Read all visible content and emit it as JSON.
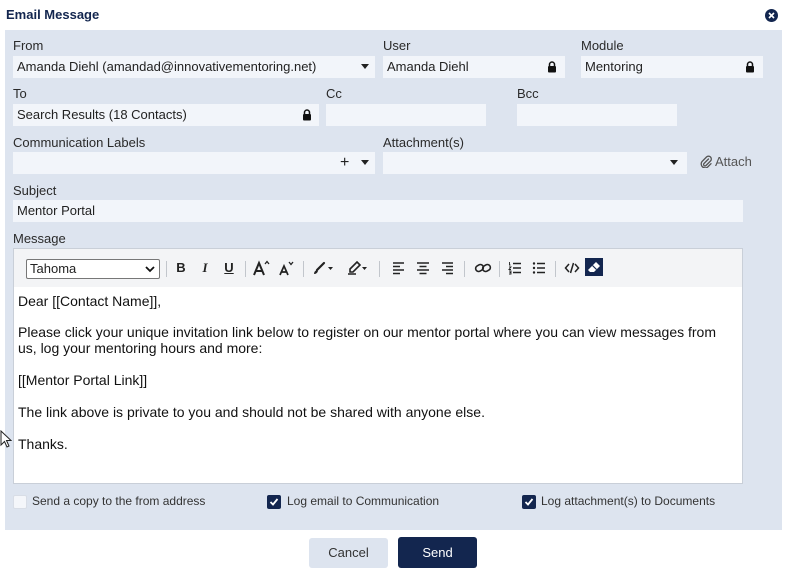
{
  "dialog": {
    "title": "Email Message"
  },
  "from": {
    "label": "From",
    "value": "Amanda Diehl (amandad@innovativementoring.net)"
  },
  "user": {
    "label": "User",
    "value": "Amanda Diehl"
  },
  "module": {
    "label": "Module",
    "value": "Mentoring"
  },
  "to": {
    "label": "To",
    "value": "Search Results (18 Contacts)"
  },
  "cc": {
    "label": "Cc",
    "value": ""
  },
  "bcc": {
    "label": "Bcc",
    "value": ""
  },
  "communication_labels": {
    "label": "Communication Labels",
    "add_symbol": "+"
  },
  "attachments": {
    "label": "Attachment(s)",
    "attach_button": "Attach"
  },
  "subject": {
    "label": "Subject",
    "value": "Mentor Portal"
  },
  "message": {
    "label": "Message",
    "font": "Tahoma",
    "toolbar": {
      "bold": "B",
      "italic": "I",
      "underline": "U"
    },
    "body": [
      "Dear [[Contact Name]],",
      "Please click your unique invitation link below to register on our mentor portal where you can view messages from us, log your mentoring hours and more:",
      "[[Mentor Portal Link]]",
      "The link above is private to you and should not be shared with anyone else.",
      "Thanks."
    ]
  },
  "options": {
    "send_copy": {
      "label": "Send a copy to the from address",
      "checked": false
    },
    "log_email": {
      "label": "Log email to Communication",
      "checked": true
    },
    "log_attachments": {
      "label": "Log attachment(s) to Documents",
      "checked": true
    }
  },
  "buttons": {
    "cancel": "Cancel",
    "send": "Send"
  },
  "colors": {
    "primary": "#13264f",
    "panel": "#dde4ef",
    "field": "#f2f5fa"
  }
}
